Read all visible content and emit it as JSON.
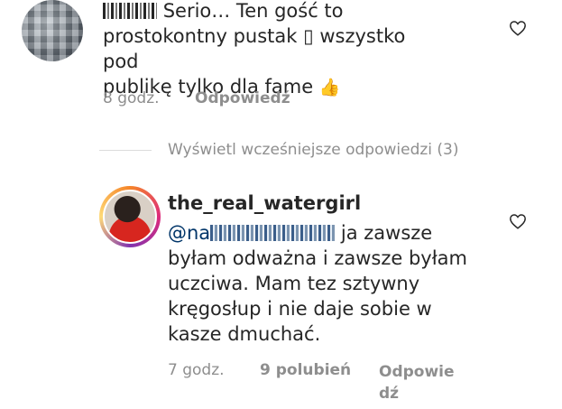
{
  "comment1": {
    "author_suffix": "Serio… Ten gość to",
    "line2": "prostokontny pustak ▯ wszystko pod",
    "line3": "publikę tylko dla fame",
    "thumbs_emoji": "👍",
    "time": "8 godz.",
    "reply_label": "Odpowiedź"
  },
  "view_previous": "Wyświetl wcześniejsze odpowiedzi (3)",
  "comment2": {
    "username": "the_real_watergirl",
    "mention_prefix": "@na",
    "line1_rest": "ja zawsze",
    "line2": "byłam odważna i zawsze byłam",
    "line3": "uczciwa. Mam tez sztywny",
    "line4": "kręgosłup i nie daje sobie w",
    "line5": "kasze dmuchać.",
    "time": "7 godz.",
    "likes": "9 polubień",
    "reply_line1": "Odpowie",
    "reply_line2": "dź"
  },
  "icons": {
    "heart": "heart-icon",
    "heart_color": "#262626"
  }
}
